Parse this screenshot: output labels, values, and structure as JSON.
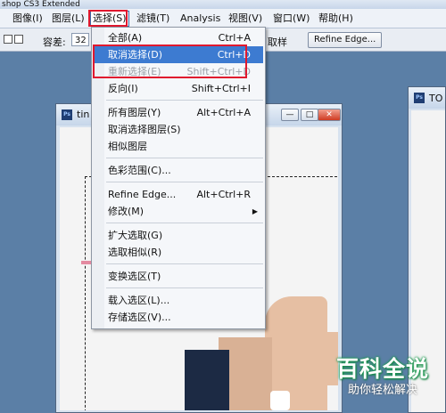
{
  "app": {
    "title": "shop CS3 Extended"
  },
  "menubar": {
    "items": [
      {
        "label": "图像(I)"
      },
      {
        "label": "图层(L)"
      },
      {
        "label": "选择(S)"
      },
      {
        "label": "滤镜(T)"
      },
      {
        "label": "Analysis"
      },
      {
        "label": "视图(V)"
      },
      {
        "label": "窗口(W)"
      },
      {
        "label": "帮助(H)"
      }
    ]
  },
  "options": {
    "tolerance_label": "容差:",
    "tolerance_value": "32",
    "sample_label": "取样",
    "refine_edge_button": "Refine Edge..."
  },
  "select_menu": {
    "items": [
      {
        "label": "全部(A)",
        "shortcut": "Ctrl+A"
      },
      {
        "label": "取消选择(D)",
        "shortcut": "Ctrl+D"
      },
      {
        "label": "重新选择(E)",
        "shortcut": "Shift+Ctrl+D"
      },
      {
        "label": "反向(I)",
        "shortcut": "Shift+Ctrl+I"
      },
      {
        "label": "所有图层(Y)",
        "shortcut": "Alt+Ctrl+A"
      },
      {
        "label": "取消选择图层(S)",
        "shortcut": ""
      },
      {
        "label": "相似图层",
        "shortcut": ""
      },
      {
        "label": "色彩范围(C)...",
        "shortcut": ""
      },
      {
        "label": "Refine Edge...",
        "shortcut": "Alt+Ctrl+R"
      },
      {
        "label": "修改(M)",
        "shortcut": ""
      },
      {
        "label": "扩大选取(G)",
        "shortcut": ""
      },
      {
        "label": "选取相似(R)",
        "shortcut": ""
      },
      {
        "label": "变换选区(T)",
        "shortcut": ""
      },
      {
        "label": "载入选区(L)...",
        "shortcut": ""
      },
      {
        "label": "存储选区(V)...",
        "shortcut": ""
      }
    ]
  },
  "document": {
    "name": "tin"
  },
  "right_doc": {
    "name": "TO"
  },
  "watermark": {
    "line1": "百科全说",
    "line2": "助你轻松解决"
  },
  "colors": {
    "highlight": "#3d7bd1",
    "annotation_red": "#e0182e"
  }
}
